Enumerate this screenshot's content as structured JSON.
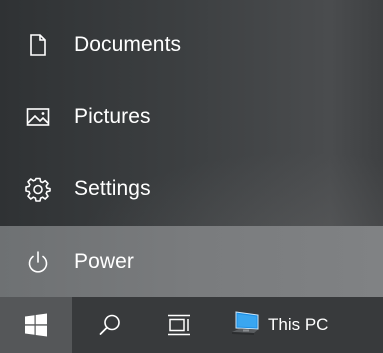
{
  "start_menu": {
    "items": [
      {
        "label": "Documents",
        "icon": "document-icon"
      },
      {
        "label": "Pictures",
        "icon": "picture-icon"
      },
      {
        "label": "Settings",
        "icon": "gear-icon"
      },
      {
        "label": "Power",
        "icon": "power-icon",
        "highlighted": true
      }
    ]
  },
  "taskbar": {
    "start": {
      "icon": "windows-logo-icon"
    },
    "search": {
      "icon": "search-icon"
    },
    "task_view": {
      "icon": "task-view-icon"
    },
    "this_pc": {
      "label": "This PC",
      "icon": "this-pc-icon"
    }
  },
  "colors": {
    "menu_bg": "#3c3f41",
    "highlight_bg": "#7a7c7e",
    "taskbar_bg": "#383a3c",
    "start_button_bg": "#555759",
    "text": "#ffffff",
    "monitor_accent": "#1e90e6"
  }
}
